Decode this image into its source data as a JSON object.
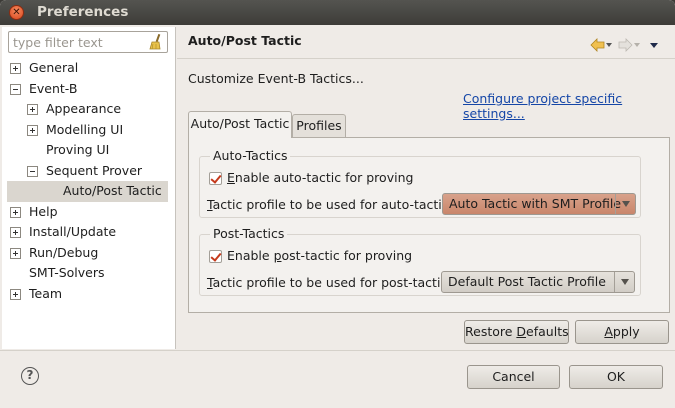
{
  "window": {
    "title": "Preferences"
  },
  "filter": {
    "placeholder": "type filter text"
  },
  "tree": [
    {
      "label": "General",
      "expander": "plus",
      "indent": 0
    },
    {
      "label": "Event-B",
      "expander": "minus",
      "indent": 0
    },
    {
      "label": "Appearance",
      "expander": "plus",
      "indent": 1
    },
    {
      "label": "Modelling UI",
      "expander": "plus",
      "indent": 1
    },
    {
      "label": "Proving UI",
      "expander": "none",
      "indent": 1
    },
    {
      "label": "Sequent Prover",
      "expander": "minus",
      "indent": 1
    },
    {
      "label": "Auto/Post Tactic",
      "expander": "none",
      "indent": 2,
      "selected": true
    },
    {
      "label": "Help",
      "expander": "plus",
      "indent": 0
    },
    {
      "label": "Install/Update",
      "expander": "plus",
      "indent": 0
    },
    {
      "label": "Run/Debug",
      "expander": "plus",
      "indent": 0
    },
    {
      "label": "SMT-Solvers",
      "expander": "none",
      "indent": 0
    },
    {
      "label": "Team",
      "expander": "plus",
      "indent": 0
    }
  ],
  "page": {
    "title": "Auto/Post Tactic",
    "description": "Customize Event-B Tactics...",
    "config_link": "Configure project specific settings..."
  },
  "tabs": {
    "active": "Auto/Post Tactic",
    "inactive": "Profiles"
  },
  "auto_tactics": {
    "group_title": "Auto-Tactics",
    "enable_pre": "",
    "enable_mnemonic": "E",
    "enable_post": "nable auto-tactic for proving",
    "checked": true,
    "profile_mnemonic": "T",
    "profile_post": "actic profile to be used for auto-tactics",
    "profile_value": "Auto Tactic with SMT Profile"
  },
  "post_tactics": {
    "group_title": "Post-Tactics",
    "enable_pre": "Enable ",
    "enable_mnemonic": "p",
    "enable_post": "ost-tactic for proving",
    "checked": true,
    "profile_mnemonic": "T",
    "profile_post": "actic profile to be used for post-tactics",
    "profile_value": "Default Post Tactic Profile"
  },
  "buttons": {
    "restore_pre": "Restore ",
    "restore_mnemonic": "D",
    "restore_post": "efaults",
    "apply_mnemonic": "A",
    "apply_post": "pply",
    "cancel": "Cancel",
    "ok": "OK"
  },
  "help": {
    "glyph": "?"
  },
  "colors": {
    "link": "#1546a7",
    "highlight_combo": "#c9866b",
    "check_mark": "#c53a1c"
  }
}
